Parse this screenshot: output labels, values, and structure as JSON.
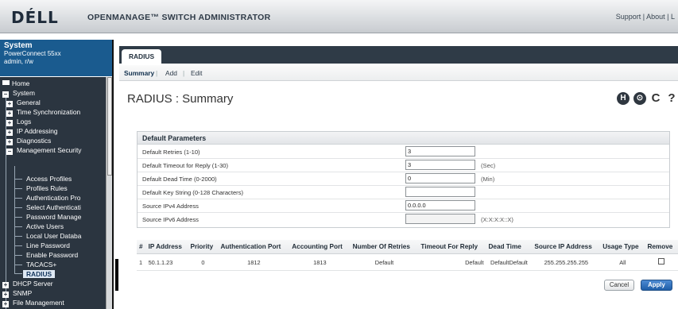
{
  "header": {
    "logo": "DÉLL",
    "app_title": "OPENMANAGE™ SWITCH ADMINISTRATOR",
    "links": [
      "Support",
      "About",
      "L"
    ]
  },
  "system": {
    "title": "System",
    "device": "PowerConnect 55xx",
    "user": "admin, r/w"
  },
  "tree": {
    "home": "Home",
    "system": "System",
    "general": "General",
    "time_sync": "Time Synchronization",
    "logs": "Logs",
    "ip_addressing": "IP Addressing",
    "diagnostics": "Diagnostics",
    "mgmt_security": "Management Security",
    "access_profiles": "Access Profiles",
    "profiles_rules": "Profiles Rules",
    "authentication_profiles": "Authentication Pro",
    "select_authentication": "Select Authenticati",
    "password_management": "Password Manage",
    "active_users": "Active Users",
    "local_user_database": "Local User Databa",
    "line_password": "Line Password",
    "enable_password": "Enable Password",
    "tacacs": "TACACS+",
    "radius": "RADIUS",
    "dhcp_server": "DHCP Server",
    "snmp": "SNMP",
    "file_management": "File Management"
  },
  "tab": {
    "label": "RADIUS"
  },
  "subnav": {
    "summary": "Summary",
    "add": "Add",
    "edit": "Edit"
  },
  "page": {
    "title": "RADIUS : Summary"
  },
  "tools": {
    "save": "H",
    "print": "⊙",
    "refresh": "C",
    "help": "?"
  },
  "params": {
    "heading": "Default Parameters",
    "retries_label": "Default Retries (1-10)",
    "retries_value": "3",
    "timeout_label": "Default Timeout for Reply (1-30)",
    "timeout_value": "3",
    "timeout_unit": "(Sec)",
    "deadtime_label": "Default Dead Time (0-2000)",
    "deadtime_value": "0",
    "deadtime_unit": "(Min)",
    "keystring_label": "Default Key String (0-128 Characters)",
    "keystring_value": "",
    "ipv4_label": "Source IPv4 Address",
    "ipv4_value": "0.0.0.0",
    "ipv6_label": "Source IPv6 Address",
    "ipv6_value": "",
    "ipv6_unit": "(X:X:X:X::X)"
  },
  "table": {
    "headers": [
      "#",
      "IP Address",
      "Priority",
      "Authentication Port",
      "Accounting Port",
      "Number Of Retries",
      "Timeout For Reply",
      "Dead Time",
      "Source IP Address",
      "Usage Type",
      "Remove"
    ],
    "row": {
      "num": "1",
      "ip": "50.1.1.23",
      "priority": "0",
      "auth_port": "1812",
      "acct_port": "1813",
      "retries": "Default",
      "timeout": "Default",
      "deadtime": "DefaultDefault",
      "source_ip": "255.255.255.255",
      "usage": "All"
    }
  },
  "buttons": {
    "cancel": "Cancel",
    "apply": "Apply"
  }
}
